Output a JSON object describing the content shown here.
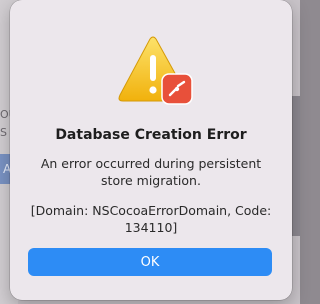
{
  "background_app": {
    "partial_text_1": "OU",
    "partial_text_2": "S",
    "partial_button": "A"
  },
  "alert": {
    "icon": "warning-triangle-with-app-badge-icon",
    "title": "Database Creation Error",
    "message": "An error occurred during persistent store migration.",
    "details": "[Domain: NSCocoaErrorDomain, Code: 134110]",
    "ok_label": "OK"
  },
  "colors": {
    "alert_background": "#ece7ec",
    "ok_button": "#2d8cf5",
    "warning_yellow": "#f5c518",
    "badge_red": "#e8503a"
  }
}
